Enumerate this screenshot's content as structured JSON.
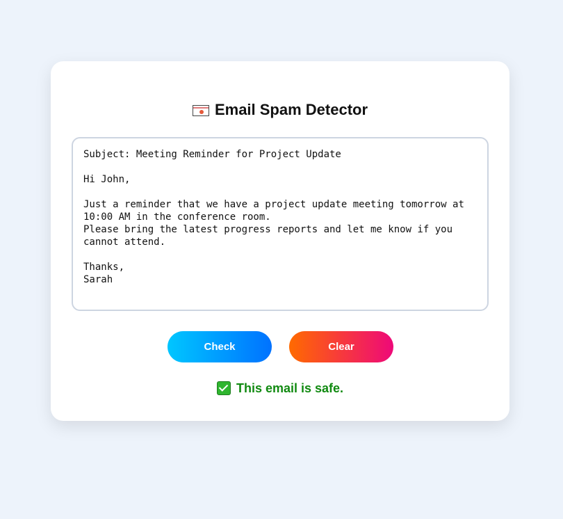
{
  "app": {
    "title": "Email Spam Detector",
    "title_icon": "envelope-icon"
  },
  "email_input": {
    "value": "Subject: Meeting Reminder for Project Update\n\nHi John,\n\nJust a reminder that we have a project update meeting tomorrow at 10:00 AM in the conference room.\nPlease bring the latest progress reports and let me know if you cannot attend.\n\nThanks,\nSarah",
    "placeholder": ""
  },
  "buttons": {
    "check_label": "Check",
    "clear_label": "Clear"
  },
  "result": {
    "icon": "check-mark-icon",
    "text": "This email is safe.",
    "color": "#118a11"
  },
  "colors": {
    "background": "#edf3fb",
    "check_gradient": [
      "#00c6ff",
      "#0072ff"
    ],
    "clear_gradient": [
      "#ff6a00",
      "#ee0979"
    ]
  }
}
